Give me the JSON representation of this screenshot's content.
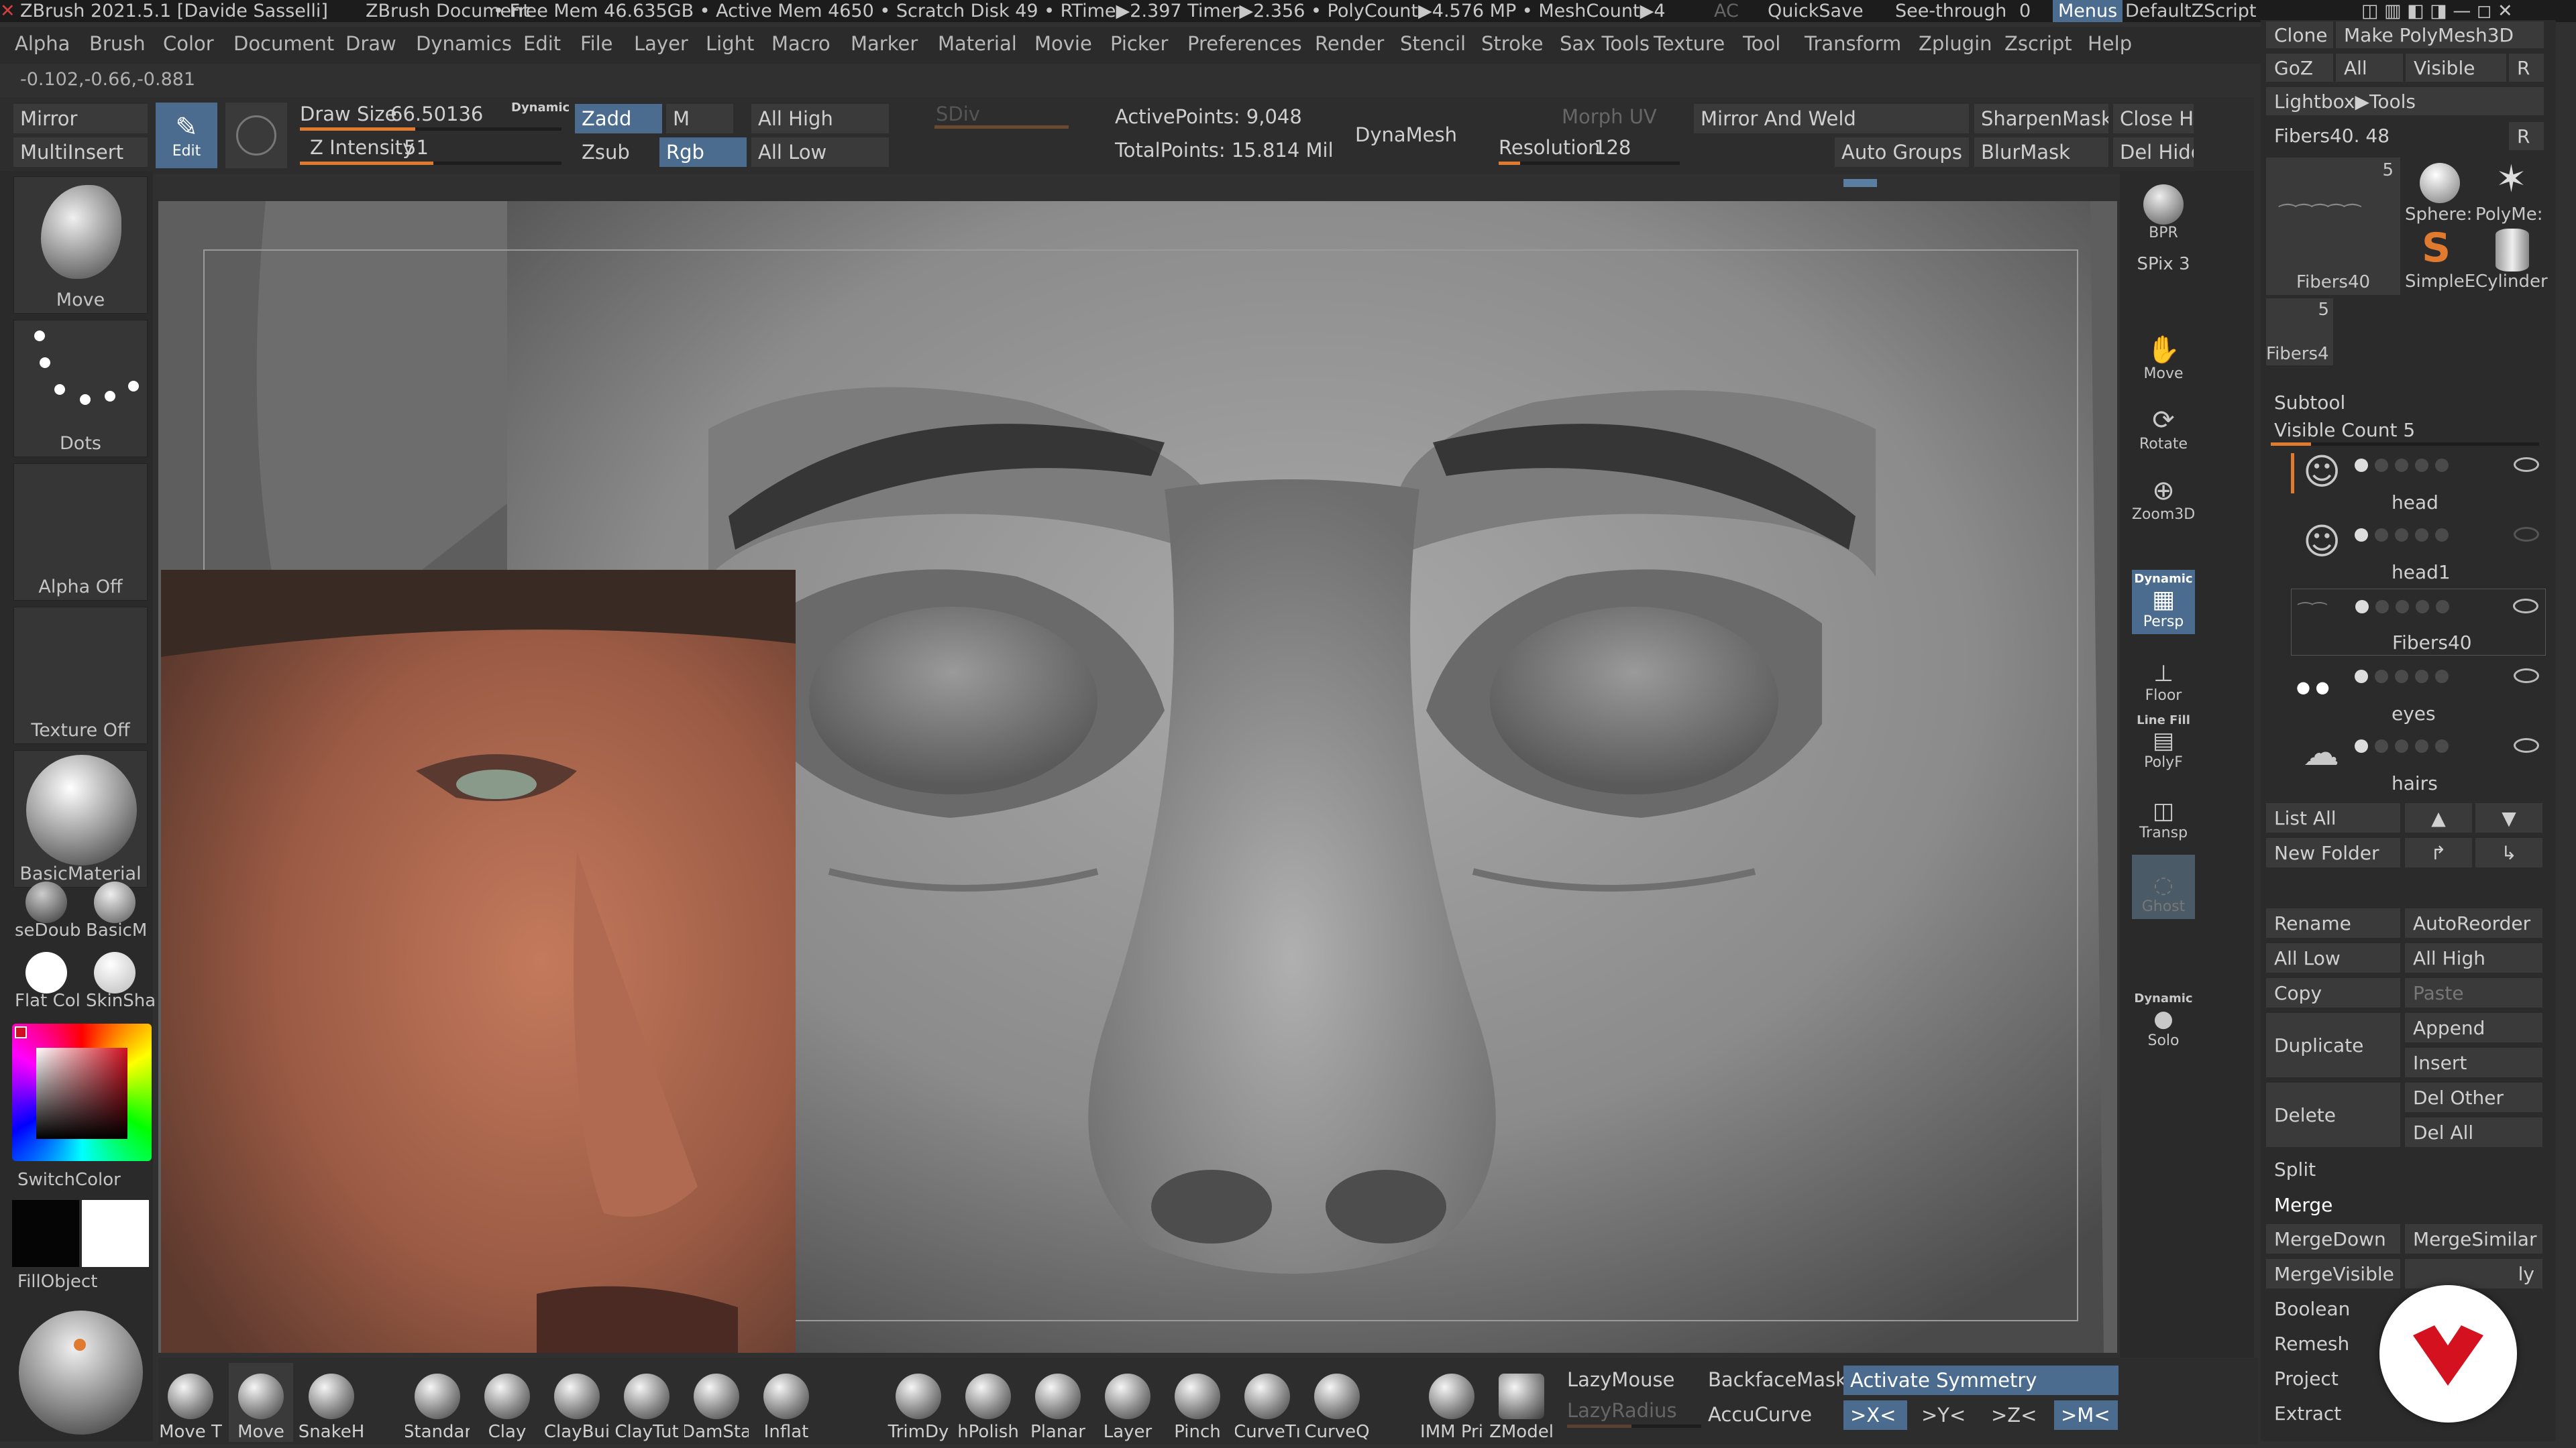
{
  "title": {
    "app": "ZBrush 2021.5.1 [Davide Sasselli]",
    "doc": "ZBrush Document",
    "stats": "• Free Mem 46.635GB • Active Mem 4650 • Scratch Disk 49 • RTime▶2.397 Timer▶2.356 • PolyCount▶4.576 MP • MeshCount▶4",
    "ac": "AC",
    "quicksave": "QuickSave",
    "seethrough": "See-through",
    "seethrough_val": "0",
    "menus": "Menus",
    "script": "DefaultZScript"
  },
  "menu": [
    "Alpha",
    "Brush",
    "Color",
    "Document",
    "Draw",
    "Dynamics",
    "Edit",
    "File",
    "Layer",
    "Light",
    "Macro",
    "Marker",
    "Material",
    "Movie",
    "Picker",
    "Preferences",
    "Render",
    "Stencil",
    "Stroke",
    "Sax Tools",
    "Texture",
    "Tool",
    "Transform",
    "Zplugin",
    "Zscript",
    "Help"
  ],
  "coords": "-0.102,-0.66,-0.881",
  "toolbar": {
    "mirror": "Mirror",
    "multiinsert": "MultiInsert",
    "edit": "Edit",
    "draw_size_label": "Draw Size",
    "draw_size": "66.50136",
    "dynamic": "Dynamic",
    "z_intensity_label": "Z Intensity",
    "z_intensity": "51",
    "zadd": "Zadd",
    "m": "M",
    "zsub": "Zsub",
    "rgb": "Rgb",
    "all_high": "All High",
    "all_low": "All Low",
    "sdiv": "SDiv",
    "active_points": "ActivePoints: 9,048",
    "total_points": "TotalPoints: 15.814 Mil",
    "dynamesh": "DynaMesh",
    "morph_uv": "Morph UV",
    "resolution_label": "Resolution",
    "resolution": "128",
    "mirror_weld": "Mirror And Weld",
    "auto_groups": "Auto Groups",
    "sharpen_mask": "SharpenMask",
    "blur_mask": "BlurMask",
    "close_holes": "Close Hc",
    "del_hidden": "Del Hidd"
  },
  "left": {
    "brush": "Move",
    "stroke": "Dots",
    "alpha": "Alpha Off",
    "texture": "Texture Off",
    "material": "BasicMaterial",
    "mat1": "seDoub",
    "mat2": "BasicM",
    "mat3": "Flat Col",
    "mat4": "SkinSha",
    "switch_color": "SwitchColor",
    "fill_object": "FillObject"
  },
  "right_shelf": [
    "BPR",
    "SPix 3",
    "Move",
    "Rotate",
    "Zoom3D",
    "Persp",
    "Floor",
    "PolyF",
    "Transp",
    "Ghost",
    "Solo"
  ],
  "right_shelf_extra": {
    "dynamic": "Dynamic",
    "line_fill": "Line Fill"
  },
  "panel": {
    "clone": "Clone",
    "make_polymesh": "Make PolyMesh3D",
    "goz": "GoZ",
    "all": "All",
    "visible": "Visible",
    "r": "R",
    "lightbox_tools": "Lightbox▶Tools",
    "fibers_label": "Fibers40. 48",
    "thumb1": "Fibers40",
    "thumb1_count": "5",
    "thumb2": "Sphere:",
    "thumb3": "PolyMe:",
    "thumb4": "SimpleE",
    "thumb5": "Cylinder",
    "thumb6": "Fibers4",
    "thumb6_count": "5",
    "subtool": "Subtool",
    "visible_count": "Visible Count 5",
    "subtools": [
      "head",
      "head1",
      "Fibers40",
      "eyes",
      "hairs"
    ],
    "list_all": "List All",
    "new_folder": "New Folder",
    "rename": "Rename",
    "auto_reorder": "AutoReorder",
    "all_low": "All Low",
    "all_high": "All High",
    "copy": "Copy",
    "paste": "Paste",
    "duplicate": "Duplicate",
    "append": "Append",
    "insert": "Insert",
    "delete": "Delete",
    "del_other": "Del Other",
    "del_all": "Del All",
    "split": "Split",
    "merge": "Merge",
    "merge_down": "MergeDown",
    "merge_similar": "MergeSimilar",
    "merge_visible": "MergeVisible",
    "merge_visible_extra": "ly",
    "boolean": "Boolean",
    "remesh": "Remesh",
    "project": "Project",
    "extract": "Extract"
  },
  "bottom": {
    "brushes": [
      "Move T",
      "Move",
      "SnakeH",
      "Standar",
      "Clay",
      "ClayBui",
      "ClayTut",
      "DamSta",
      "Inflat",
      "TrimDy",
      "hPolish",
      "Planar",
      "Layer",
      "Pinch",
      "CurveTı",
      "CurveQ",
      "IMM Pri",
      "ZModel"
    ],
    "lazy_mouse": "LazyMouse",
    "lazy_radius": "LazyRadius",
    "backface_mask": "BackfaceMask",
    "accucurve": "AccuCurve",
    "activate_symmetry": "Activate Symmetry",
    "sym_x": ">X<",
    "sym_y": ">Y<",
    "sym_z": ">Z<",
    "sym_m": ">M<"
  },
  "colors": {
    "accent_orange": "#e07a2e",
    "accent_blue": "#4b6c8e",
    "logo_red": "#d4111f"
  }
}
